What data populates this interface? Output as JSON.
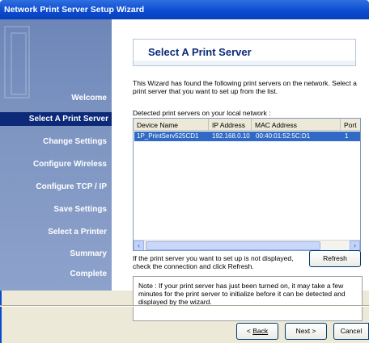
{
  "window": {
    "title": "Network Print Server Setup Wizard"
  },
  "sidebar": {
    "steps": [
      {
        "label": "Welcome",
        "active": false
      },
      {
        "label": "Select A Print Server",
        "active": true
      },
      {
        "label": "Change Settings",
        "active": false
      },
      {
        "label": "Configure Wireless",
        "active": false
      },
      {
        "label": "Configure TCP / IP",
        "active": false
      },
      {
        "label": "Save Settings",
        "active": false
      },
      {
        "label": "Select a Printer",
        "active": false
      },
      {
        "label": "Summary",
        "active": false
      },
      {
        "label": "Complete",
        "active": false
      }
    ]
  },
  "main": {
    "heading": "Select A Print Server",
    "description": "This Wizard has found the following print servers on the network. Select a print server that you want to set up from the list.",
    "detected_label": "Detected print servers on your local network :",
    "table": {
      "columns": [
        "Device Name",
        "IP Address",
        "MAC Address",
        "Port"
      ],
      "rows": [
        {
          "device_name": "1P_PrintServ525CD1",
          "ip_address": "192.168.0.10",
          "mac_address": "00:40:01:52:5C:D1",
          "port": "1",
          "selected": true
        }
      ]
    },
    "hint": "If the print server you want to set up is not displayed, check the connection and click Refresh.",
    "refresh_label": "Refresh",
    "note": "Note : If your print server has just been turned on, it may take a few minutes for the print server to initialize before it can be detected and displayed by the wizard."
  },
  "footer": {
    "back_label": "Back",
    "next_label": "Next >",
    "cancel_label": "Cancel"
  },
  "colors": {
    "title_bar": "#0a4ad0",
    "selection": "#316ac5",
    "heading": "#0c2a78",
    "sidebar": "#7e95c2"
  }
}
